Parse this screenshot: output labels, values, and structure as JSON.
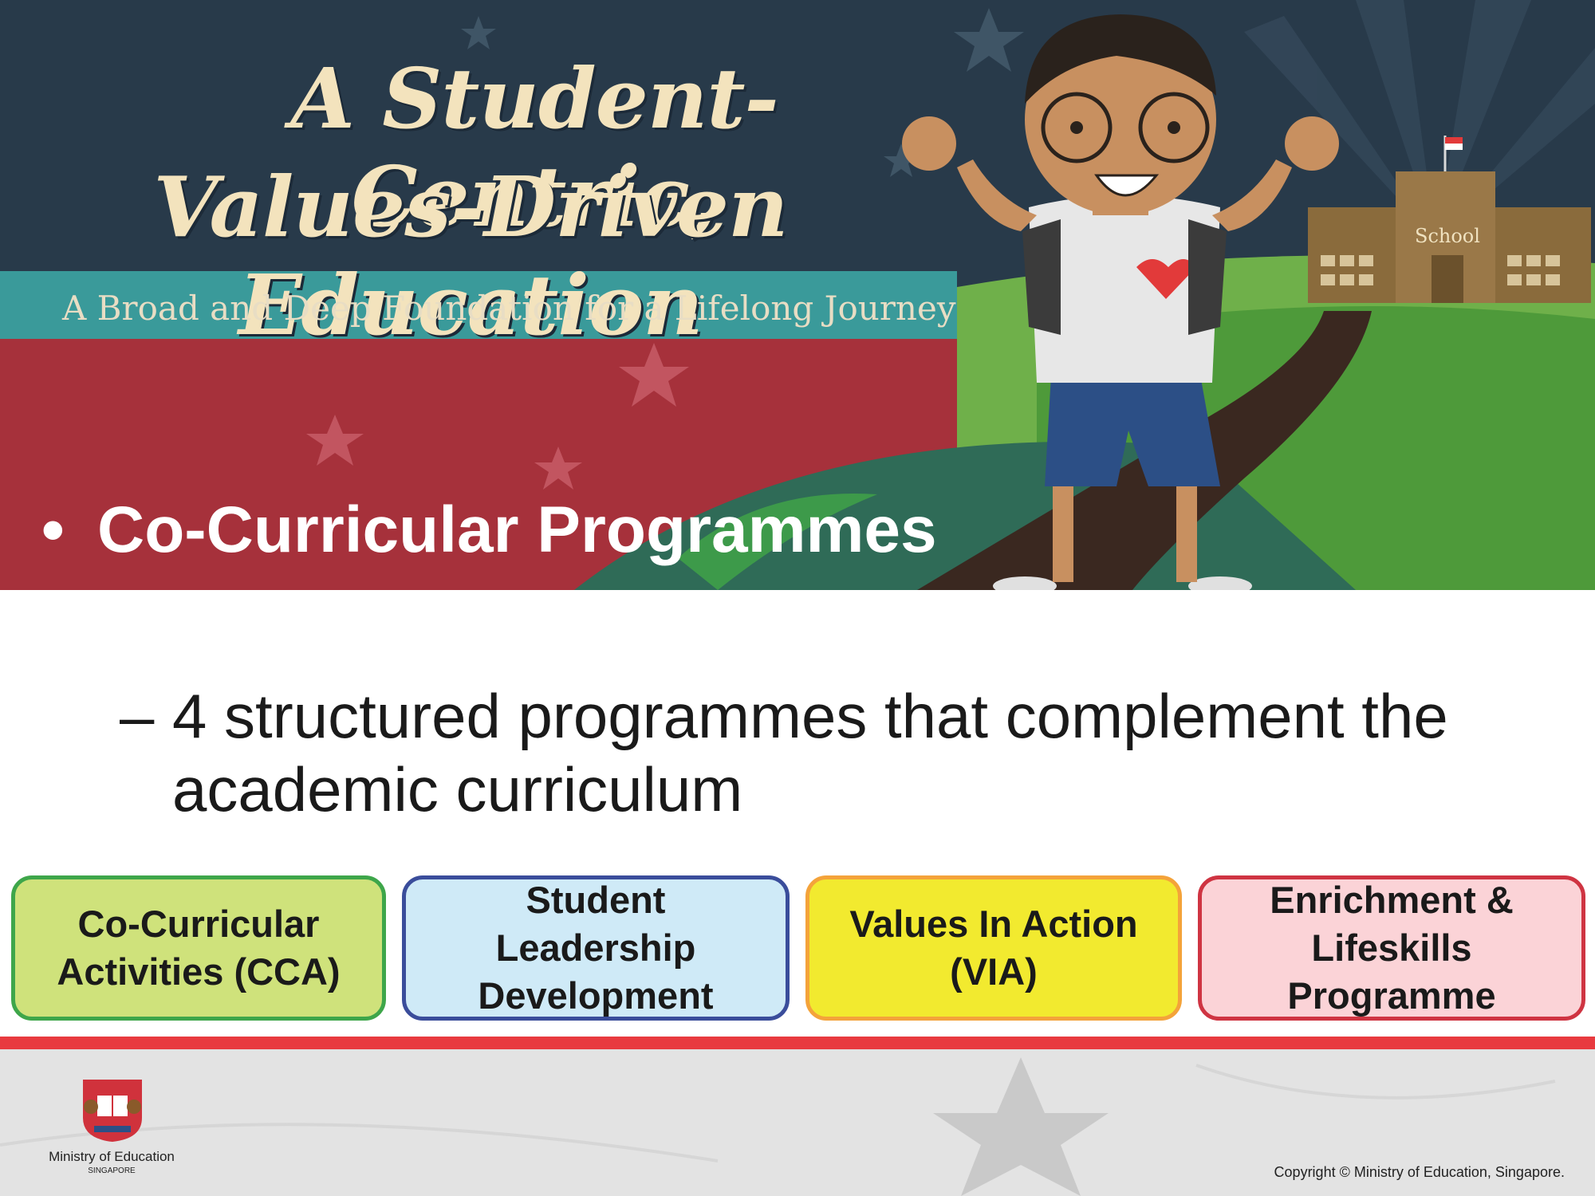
{
  "banner": {
    "title_line1": "A Student-Centric,",
    "title_line2": "Values-Driven Education",
    "subtitle": "A Broad and Deep Foundation for a Lifelong Journey",
    "school_sign": "School"
  },
  "slide": {
    "bullet_marker": "•",
    "bullet": "Co-Curricular Programmes",
    "sub_bullet_marker": "–",
    "sub_bullet": "4 structured programmes that complement the academic curriculum"
  },
  "programmes": [
    {
      "label": "Co-Curricular Activities (CCA)",
      "fill": "#cfe27b",
      "border": "#3ea64a"
    },
    {
      "label": "Student Leadership Development",
      "fill": "#cfeaf7",
      "border": "#3a4d9b"
    },
    {
      "label": "Values In Action (VIA)",
      "fill": "#f2ea2f",
      "border": "#f4a33a"
    },
    {
      "label": "Enrichment & Lifeskills Programme",
      "fill": "#fbd3d7",
      "border": "#cf3442"
    }
  ],
  "footer": {
    "ministry": "Ministry of Education",
    "country": "SINGAPORE",
    "copyright": "Copyright © Ministry of Education, Singapore."
  },
  "colors": {
    "banner_top": "#283a4a",
    "banner_teal": "#3a9a9a",
    "banner_red": "#a6313b",
    "accent_line": "#e83a3f"
  }
}
